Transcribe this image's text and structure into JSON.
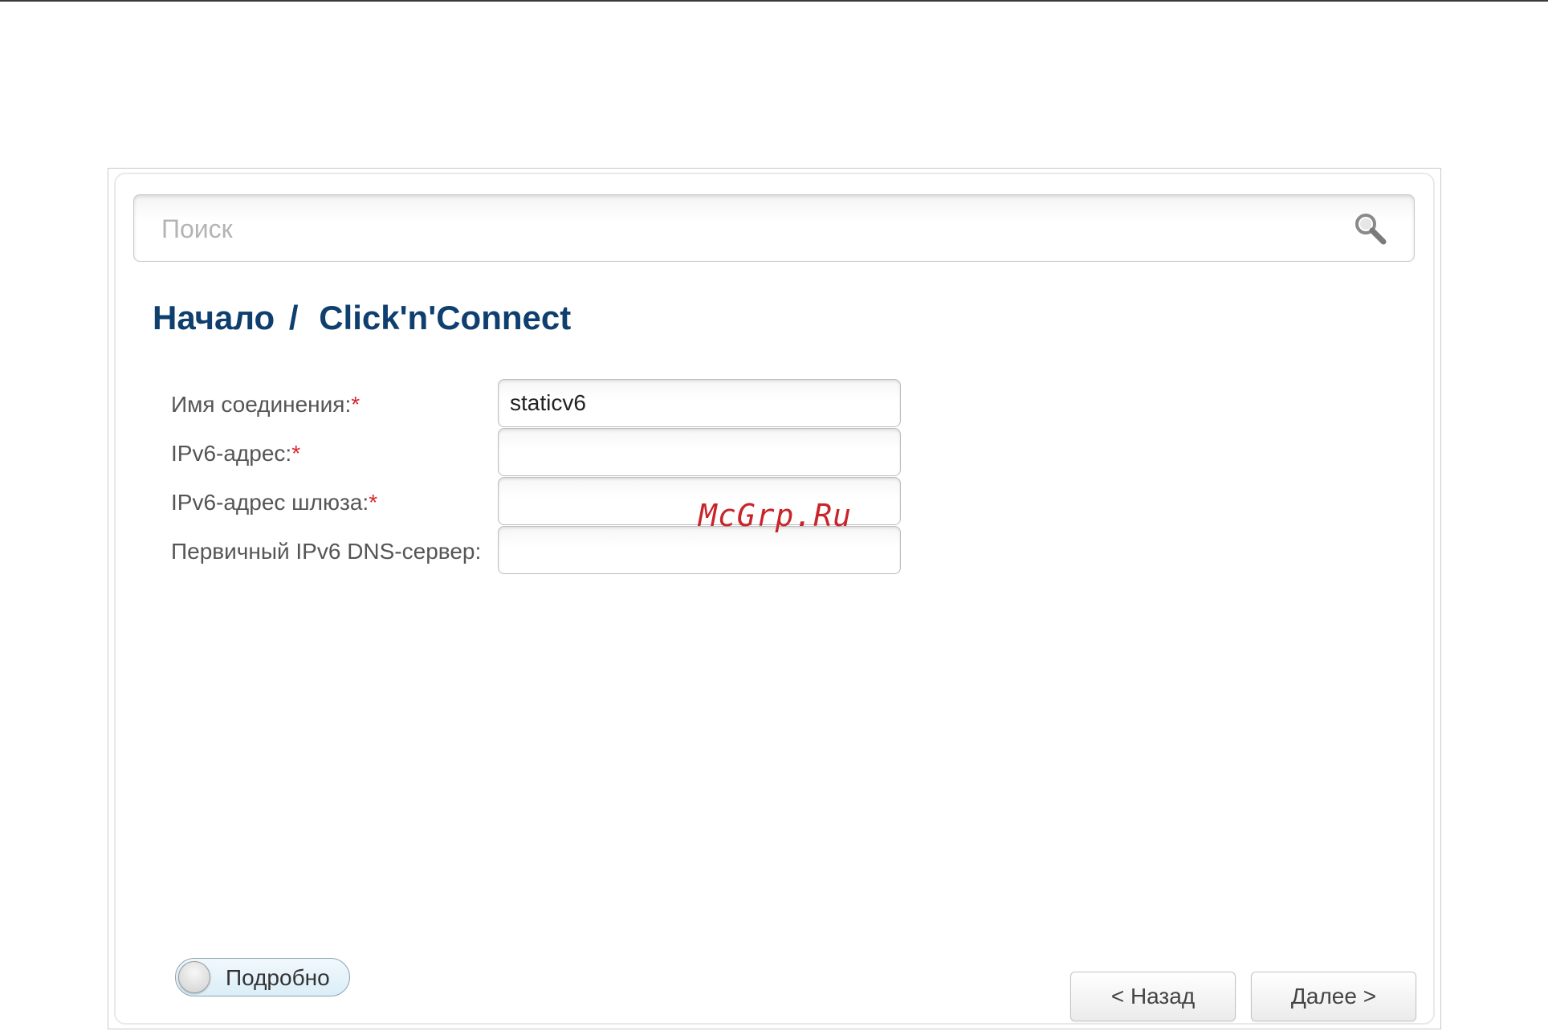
{
  "search": {
    "placeholder": "Поиск",
    "icon": "search-icon"
  },
  "breadcrumb": {
    "root": "Начало",
    "separator": "/",
    "current": "Click'n'Connect"
  },
  "form": {
    "required_mark": "*",
    "fields": [
      {
        "label": "Имя соединения:",
        "required": true,
        "value": "staticv6"
      },
      {
        "label": "IPv6-адрес:",
        "required": true,
        "value": ""
      },
      {
        "label": "IPv6-адрес шлюза:",
        "required": true,
        "value": ""
      },
      {
        "label": "Первичный IPv6 DNS-сервер:",
        "required": false,
        "value": ""
      }
    ]
  },
  "watermark": "McGrp.Ru",
  "details_toggle": {
    "label": "Подробно",
    "state": "off"
  },
  "buttons": {
    "back": "< Назад",
    "next": "Далее >"
  },
  "colors": {
    "title": "#0e3f6e",
    "required": "#d8262c",
    "watermark": "#c8252b"
  }
}
